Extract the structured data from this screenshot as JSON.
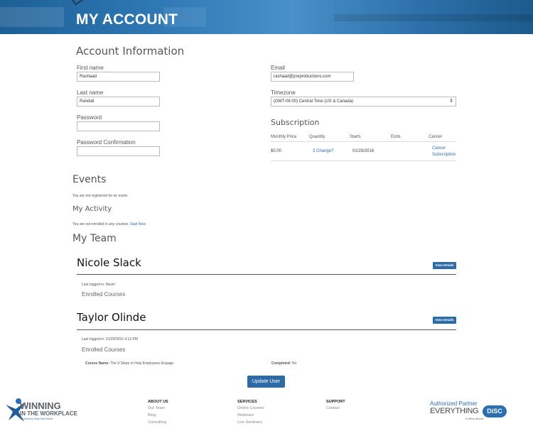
{
  "header": {
    "title": "MY ACCOUNT"
  },
  "account": {
    "heading": "Account Information",
    "first_name_label": "First name",
    "first_name_value": "Rashaad",
    "last_name_label": "Last name",
    "last_name_value": "Randall",
    "password_label": "Password",
    "password_confirm_label": "Password Confirmation",
    "email_label": "Email",
    "email_value": "rashaad@jcwproductions.com",
    "timezone_label": "Timezone",
    "timezone_value": "(GMT-06:00) Central Time (US & Canada)"
  },
  "subscription": {
    "heading": "Subscription",
    "columns": [
      "Monthly Price",
      "Quantity",
      "Starts",
      "Ends",
      "Cancel"
    ],
    "row": {
      "price": "$0.00",
      "quantity": "3",
      "change_link": "Change?",
      "starts": "01/29/2016",
      "ends": "",
      "cancel_line1": "Cancel",
      "cancel_line2": "Subscription"
    }
  },
  "events": {
    "heading": "Events",
    "message": "You are not registered for an event."
  },
  "activity": {
    "heading": "My Activity",
    "message": "You are not enrolled in any courses.",
    "link": "Start Now"
  },
  "team": {
    "heading": "My Team",
    "view_details_label": "View Details",
    "enrolled_courses_label": "Enrolled Courses",
    "members": [
      {
        "name": "Nicole Slack",
        "last_logged": "Last logged in: Never"
      },
      {
        "name": "Taylor Olinde",
        "last_logged": "Last logged in: 01/29/2016 4:13 PM",
        "course_name_label": "Course Name:",
        "course_name": "The 9 Steps to Help Employees Engage",
        "completed_label": "Completed:",
        "completed": "No"
      }
    ]
  },
  "update_button": "Update User",
  "footer": {
    "logo_line1": "WINNING",
    "logo_line2": "IN THE WORKPLACE",
    "logo_line3": "Powered by Team Real World",
    "columns": [
      {
        "title": "ABOUT US",
        "items": [
          "Our Team",
          "Blog",
          "Consulting"
        ]
      },
      {
        "title": "SERVICES",
        "items": [
          "Online Courses",
          "Webinars",
          "Live Seminars"
        ]
      },
      {
        "title": "SUPPORT",
        "items": [
          "Contact"
        ]
      }
    ],
    "partner_line1": "Authorized Partner",
    "partner_brand": "EVERYTHING",
    "partner_disc": "DiSC",
    "partner_sub": "A Wiley Brand"
  },
  "colors": {
    "primary_blue": "#2c6ba5",
    "link_blue": "#2d6da3",
    "banner_blue": "#2f79b6"
  }
}
